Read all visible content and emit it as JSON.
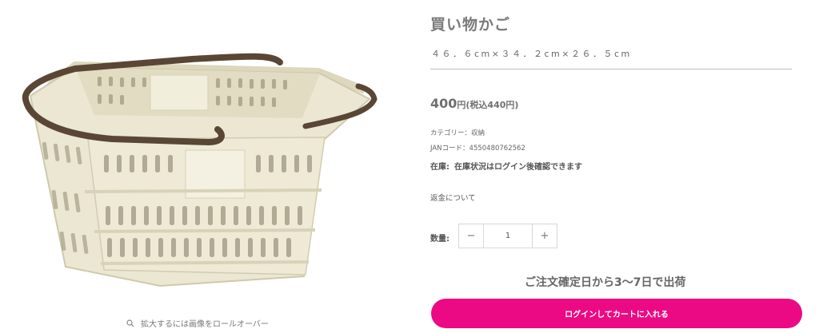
{
  "product": {
    "title": "買い物かご",
    "size": "４６．６cm×３４．２cm×２６．５cm",
    "price_main": "400",
    "price_unit": "円",
    "price_tax": "(税込440円)",
    "category": "カテゴリー：収納",
    "jan": "JANコード：4550480762562",
    "stock_label": "在庫:",
    "stock_text": "在庫状況はログイン後確認できます",
    "refund_link": "返金について",
    "image_icon": "shopping-basket",
    "basket_color": "#ebe7d2",
    "handle_color": "#5a4634"
  },
  "zoom_hint": {
    "icon": "search-icon",
    "text": "拡大するには画像をロールオーバー"
  },
  "quantity": {
    "label": "数量:",
    "minus": "−",
    "plus": "+",
    "value": "1"
  },
  "shipping_note": "ご注文確定日から3〜7日で出荷",
  "cart_button": {
    "label": "ログインしてカートに入れる",
    "color": "#ec0a84"
  }
}
